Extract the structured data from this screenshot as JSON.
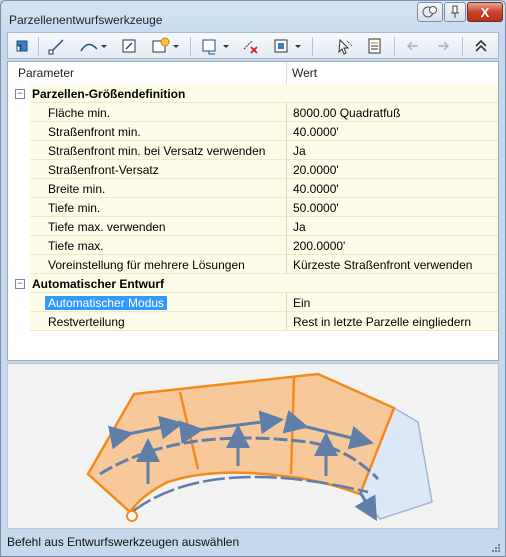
{
  "window": {
    "title": "Parzellenentwurfswerkzeuge",
    "help_icon": "help-icon",
    "pin_icon": "pin-icon",
    "close_label": "X"
  },
  "toolbar": {
    "icons": [
      "parcel-layout-icon",
      "line-tool-icon",
      "curve-tool-icon",
      "free-form-icon",
      "slide-line-create-icon",
      "swing-line-icon",
      "delete-subentity-icon",
      "parcel-union-icon",
      "select-entity-icon",
      "edit-table-icon",
      "undo-icon",
      "redo-icon",
      "collapse-icon"
    ]
  },
  "grid": {
    "header_parameter": "Parameter",
    "header_value": "Wert",
    "categories": [
      {
        "name": "Parzellen-Größendefinition",
        "expander": "−",
        "rows": [
          {
            "label": "Fläche min.",
            "value": "8000.00 Quadratfuß"
          },
          {
            "label": "Straßenfront min.",
            "value": "40.0000'"
          },
          {
            "label": "Straßenfront min. bei Versatz verwenden",
            "value": "Ja"
          },
          {
            "label": "Straßenfront-Versatz",
            "value": "20.0000'"
          },
          {
            "label": "Breite min.",
            "value": "40.0000'"
          },
          {
            "label": "Tiefe min.",
            "value": "50.0000'"
          },
          {
            "label": "Tiefe max. verwenden",
            "value": "Ja"
          },
          {
            "label": "Tiefe max.",
            "value": "200.0000'"
          },
          {
            "label": "Voreinstellung für mehrere Lösungen",
            "value": "Kürzeste Straßenfront verwenden"
          }
        ]
      },
      {
        "name": "Automatischer Entwurf",
        "expander": "−",
        "rows": [
          {
            "label": "Automatischer Modus",
            "value": "Ein",
            "selected": true
          },
          {
            "label": "Restverteilung",
            "value": "Rest in letzte Parzelle eingliedern"
          }
        ]
      }
    ]
  },
  "status": {
    "text": "Befehl aus Entwurfswerkzeugen auswählen"
  },
  "colors": {
    "parcel_fill": "#f7c99a",
    "parcel_stroke": "#f28a1e",
    "remainder_fill": "#dbe8f7",
    "arrow": "#5f7fa8",
    "selection": "#3399ff"
  }
}
